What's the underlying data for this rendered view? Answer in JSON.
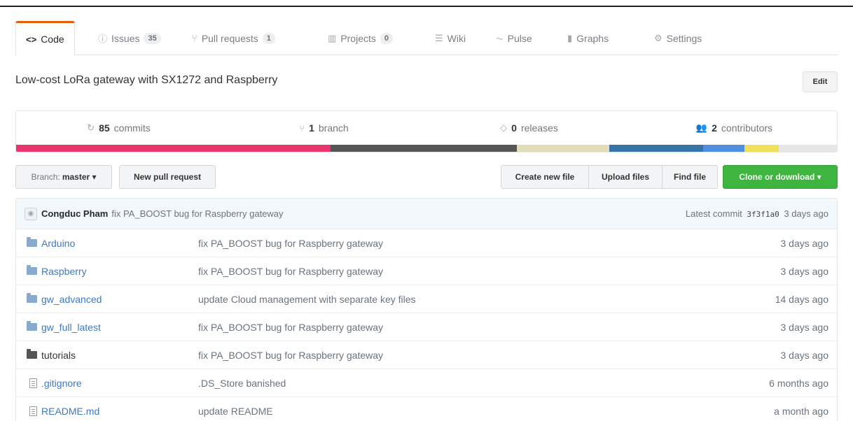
{
  "tabs": [
    {
      "label": "Code",
      "icon": "code-icon",
      "counter": ""
    },
    {
      "label": "Issues",
      "icon": "issue-icon",
      "counter": "35"
    },
    {
      "label": "Pull requests",
      "icon": "pull-request-icon",
      "counter": "1"
    },
    {
      "label": "Projects",
      "icon": "project-icon",
      "counter": "0"
    },
    {
      "label": "Wiki",
      "icon": "book-icon",
      "counter": ""
    },
    {
      "label": "Pulse",
      "icon": "pulse-icon",
      "counter": ""
    },
    {
      "label": "Graphs",
      "icon": "graph-icon",
      "counter": ""
    },
    {
      "label": "Settings",
      "icon": "gear-icon",
      "counter": ""
    }
  ],
  "repo": {
    "description": "Low-cost LoRa gateway with SX1272 and Raspberry",
    "edit_label": "Edit"
  },
  "summary": {
    "commits_count": "85",
    "commits_label": "commits",
    "branch_count": "1",
    "branch_label": "branch",
    "releases_count": "0",
    "releases_label": "releases",
    "contributors_count": "2",
    "contributors_label": "contributors"
  },
  "language_bar": [
    {
      "color": "#e8356e",
      "fraction": 0.383
    },
    {
      "color": "#555555",
      "fraction": 0.227
    },
    {
      "color": "#e3dcbb",
      "fraction": 0.113
    },
    {
      "color": "#3572a5",
      "fraction": 0.114
    },
    {
      "color": "#4f8fe0",
      "fraction": 0.05
    },
    {
      "color": "#f1e05a",
      "fraction": 0.042
    },
    {
      "color": "#e6e6e6",
      "fraction": 0.071
    }
  ],
  "toolbar": {
    "branch_prefix": "Branch:",
    "branch_name": "master ▾",
    "new_pr": "New pull request",
    "create_file": "Create new file",
    "upload_files": "Upload files",
    "find_file": "Find file",
    "clone": "Clone or download ▾"
  },
  "latest_commit": {
    "author": "Congduc Pham",
    "message": "fix PA_BOOST bug for Raspberry gateway",
    "prefix": "Latest commit",
    "sha": "3f3f1a0",
    "age": "3 days ago"
  },
  "files": [
    {
      "name": "Arduino",
      "type": "dir",
      "message": "fix PA_BOOST bug for Raspberry gateway",
      "age": "3 days ago"
    },
    {
      "name": "Raspberry",
      "type": "dir",
      "message": "fix PA_BOOST bug for Raspberry gateway",
      "age": "3 days ago"
    },
    {
      "name": "gw_advanced",
      "type": "dir",
      "message": "update Cloud management with separate key files",
      "age": "14 days ago"
    },
    {
      "name": "gw_full_latest",
      "type": "dir",
      "message": "fix PA_BOOST bug for Raspberry gateway",
      "age": "3 days ago"
    },
    {
      "name": "tutorials",
      "type": "dir-plain",
      "message": "fix PA_BOOST bug for Raspberry gateway",
      "age": "3 days ago"
    },
    {
      "name": ".gitignore",
      "type": "file",
      "message": ".DS_Store banished",
      "age": "6 months ago"
    },
    {
      "name": "README.md",
      "type": "file",
      "message": "update README",
      "age": "a month ago"
    }
  ]
}
